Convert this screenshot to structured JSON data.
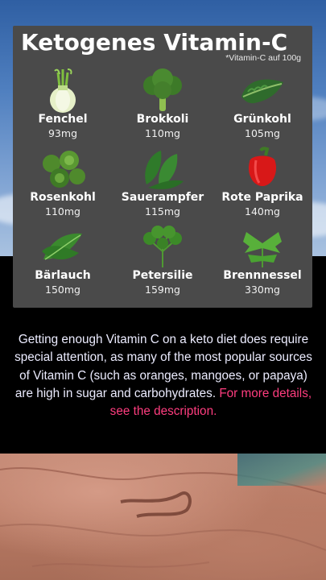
{
  "card": {
    "title": "Ketogenes Vitamin-C",
    "note": "*Vitamin-C auf 100g",
    "items": [
      {
        "name": "Fenchel",
        "amount": "93mg",
        "icon": "fennel-icon"
      },
      {
        "name": "Brokkoli",
        "amount": "110mg",
        "icon": "broccoli-icon"
      },
      {
        "name": "Grünkohl",
        "amount": "105mg",
        "icon": "kale-icon"
      },
      {
        "name": "Rosenkohl",
        "amount": "110mg",
        "icon": "brussels-sprouts-icon"
      },
      {
        "name": "Sauerampfer",
        "amount": "115mg",
        "icon": "sorrel-icon"
      },
      {
        "name": "Rote Paprika",
        "amount": "140mg",
        "icon": "red-pepper-icon"
      },
      {
        "name": "Bärlauch",
        "amount": "150mg",
        "icon": "wild-garlic-icon"
      },
      {
        "name": "Petersilie",
        "amount": "159mg",
        "icon": "parsley-icon"
      },
      {
        "name": "Brennnessel",
        "amount": "330mg",
        "icon": "nettle-icon"
      }
    ]
  },
  "caption": {
    "text": "Getting enough Vitamin C on a keto diet does require special attention, as many of the most popular sources of Vitamin C (such as oranges, mangoes, or papaya) are high in sugar and carbohydrates.",
    "link": "For more details, see the description."
  },
  "colors": {
    "card_bg": "#4a4a4a",
    "caption_text": "#ececff",
    "link": "#ff3d7f"
  }
}
